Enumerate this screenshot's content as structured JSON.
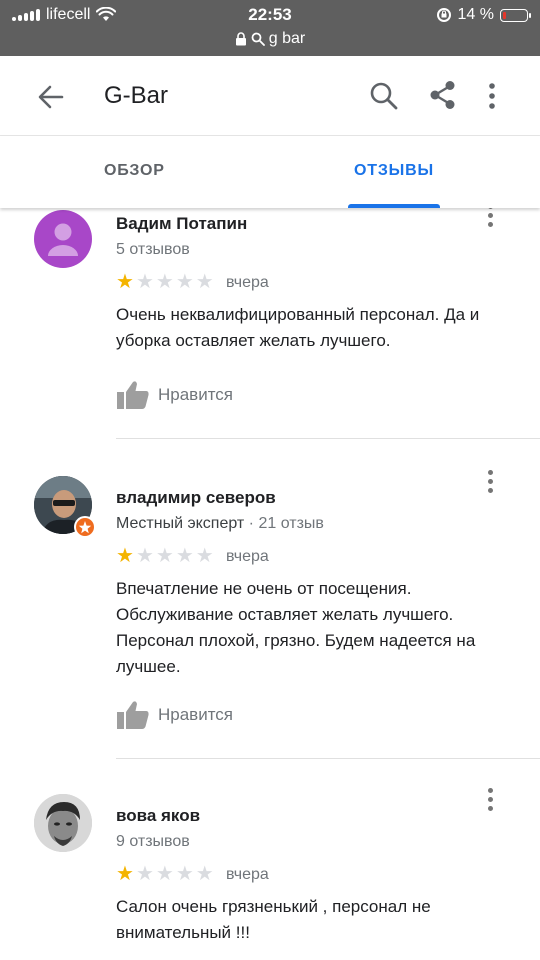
{
  "status_bar": {
    "carrier": "lifecell",
    "time": "22:53",
    "battery": "14 %",
    "battery_level": 0.14,
    "url": "g bar"
  },
  "header": {
    "title": "G-Bar",
    "icons": [
      "arrow-back-icon",
      "search-icon",
      "share-icon",
      "more-vert-icon"
    ]
  },
  "tabs": [
    {
      "label": "ОБЗОР",
      "active": false
    },
    {
      "label": "ОТЗЫВЫ",
      "active": true
    }
  ],
  "colors": {
    "accent": "#1a73e8",
    "star": "#f4b400",
    "statusbar": "#5f5f5f"
  },
  "reviews": [
    {
      "author": "Вадим Потапин",
      "meta": "5 отзывов",
      "rating": 1,
      "date": "вчера",
      "text": "Очень неквалифицированный персонал. Да и уборка оставляет желать лучшего.",
      "like_label": "Нравится"
    },
    {
      "author": "владимир северов",
      "meta_guide": "Местный эксперт",
      "meta_sep": " · ",
      "meta_count": "21 отзыв",
      "rating": 1,
      "date": "вчера",
      "text": "Впечатление не очень от посещения. Обслуживание оставляет желать лучшего. Персонал плохой, грязно. Будем надеется на лучшее.",
      "like_label": "Нравится"
    },
    {
      "author": "вова яков",
      "meta": "9 отзывов",
      "rating": 1,
      "date": "вчера",
      "text": "Салон очень грязненький , персонал не внимательный !!!"
    }
  ]
}
